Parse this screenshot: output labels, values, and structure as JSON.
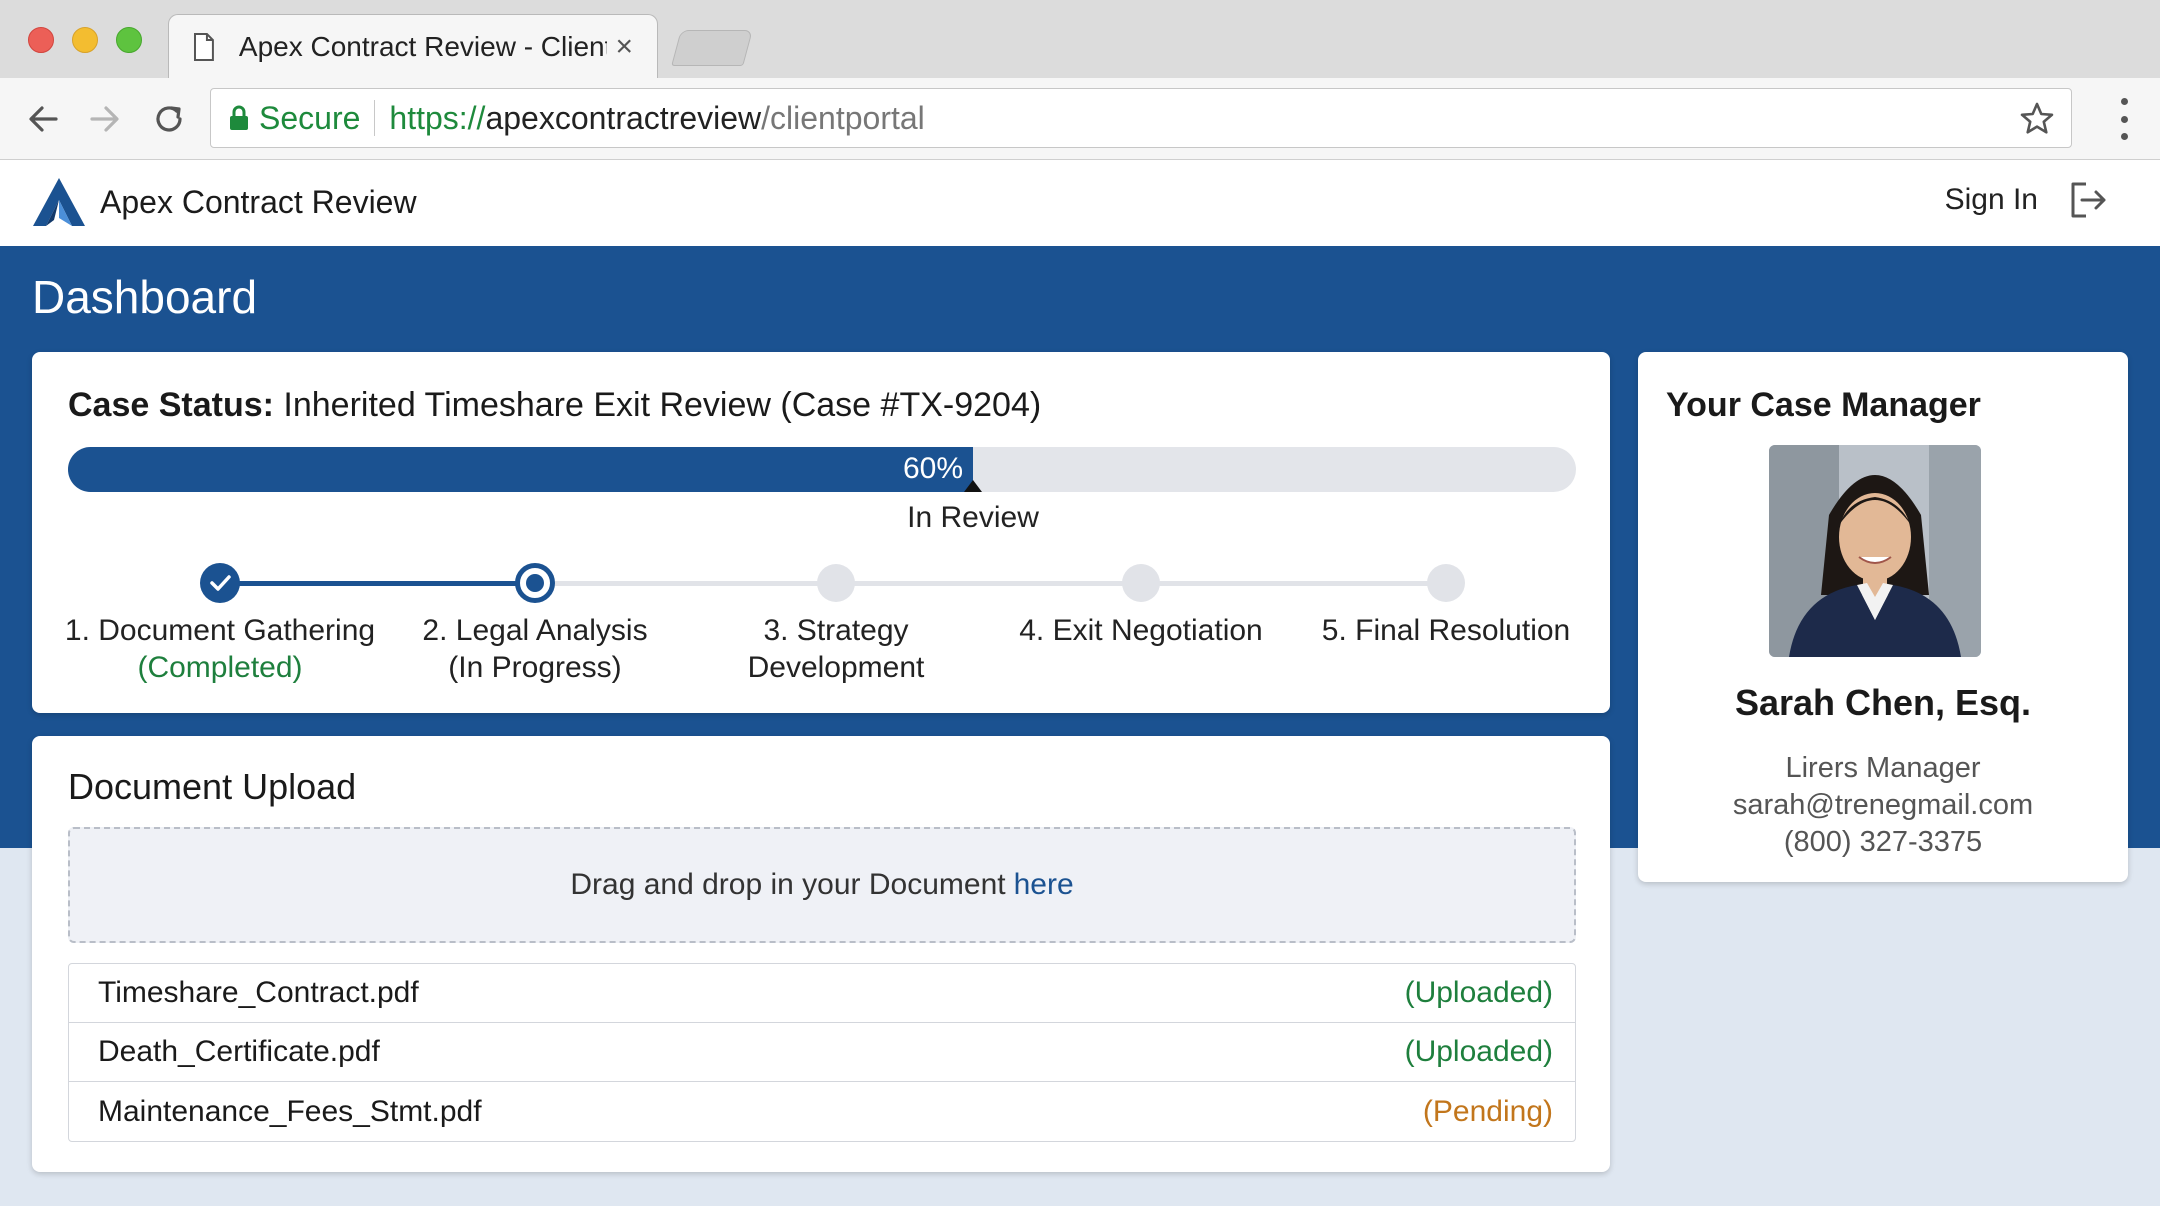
{
  "browser": {
    "tab_title": "Apex Contract Review - Client",
    "tab_close": "×",
    "secure_label": "Secure",
    "url_scheme": "https://",
    "url_host": "apexcontractreview",
    "url_path": "/clientportal"
  },
  "header": {
    "brand_name": "Apex Contract Review",
    "signin_label": "Sign In"
  },
  "dashboard": {
    "title": "Dashboard"
  },
  "case_status": {
    "label": "Case Status:",
    "case_title": " Inherited Timeshare Exit Review (Case #TX-9204)",
    "progress": 0.6,
    "progress_label": "60%",
    "state_label": "In Review",
    "steps": [
      {
        "line1": "1. Document Gathering",
        "line2": "(Completed)",
        "state": "done"
      },
      {
        "line1": "2. Legal Analysis",
        "line2": "(In Progress)",
        "state": "current"
      },
      {
        "line1": "3. Strategy",
        "line2": "Development",
        "state": "todo"
      },
      {
        "line1": "4. Exit Negotiation",
        "line2": "",
        "state": "todo"
      },
      {
        "line1": "5. Final Resolution",
        "line2": "",
        "state": "todo"
      }
    ]
  },
  "upload": {
    "title": "Document Upload",
    "drop_text": "Drag and drop in your Document",
    "drop_link": "here",
    "files": [
      {
        "name": "Timeshare_Contract.pdf",
        "status": "(Uploaded)",
        "status_color": "#1e7f3d"
      },
      {
        "name": "Death_Certificate.pdf",
        "status": "(Uploaded)",
        "status_color": "#1e7f3d"
      },
      {
        "name": "Maintenance_Fees_Stmt.pdf",
        "status": "(Pending)",
        "status_color": "#c2761c"
      }
    ]
  },
  "manager": {
    "title": "Your Case Manager",
    "name": "Sarah Chen, Esq.",
    "role": "Lirers Manager",
    "email": "sarah@trenegmail.com",
    "phone": "(800) 327-3375"
  },
  "colors": {
    "brand_blue": "#1b5291",
    "success": "#1e7f3d",
    "pending": "#c2761c"
  }
}
